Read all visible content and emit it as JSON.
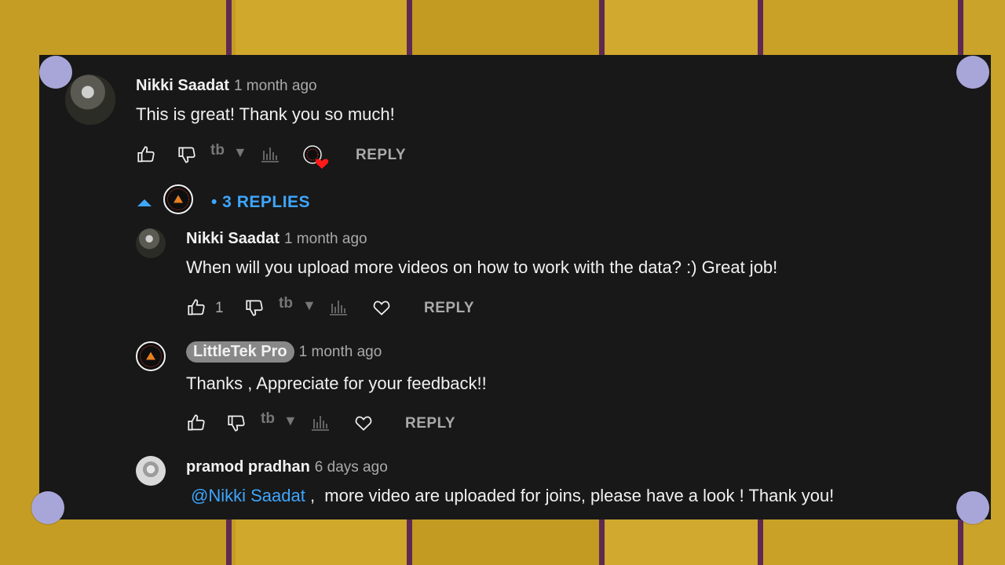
{
  "colors": {
    "panel_bg": "#181818",
    "text_primary": "#f1f1f1",
    "text_secondary": "#aaaaaa",
    "accent_blue": "#3ea6ff",
    "heart_red": "#ff0000",
    "pin": "#a8a6d8",
    "wood": "#c9a227"
  },
  "comment": {
    "author": "Nikki Saadat",
    "time": "1 month ago",
    "text": "This is great! Thank you so much!",
    "reply_label": "REPLY",
    "hearted_icon": "creator-heart-icon"
  },
  "replies_toggle": {
    "label": "• 3 REPLIES",
    "icon": "chevron-up-icon"
  },
  "replies": [
    {
      "author": "Nikki Saadat",
      "time": "1 month ago",
      "text": "When will you upload more videos on how to work with the data? :) Great job!",
      "likes": "1",
      "reply_label": "REPLY"
    },
    {
      "author": "LittleTek Pro",
      "time": "1 month ago",
      "text": "Thanks , Appreciate for your feedback!!",
      "reply_label": "REPLY"
    },
    {
      "author": "pramod pradhan",
      "time": "6 days ago",
      "mention": "@Nikki Saadat",
      "text": " ,  more video are uploaded for joins, please have a look ! Thank you!"
    }
  ],
  "extension": {
    "logo_text": "tb",
    "icon": "chart-bars-icon"
  }
}
